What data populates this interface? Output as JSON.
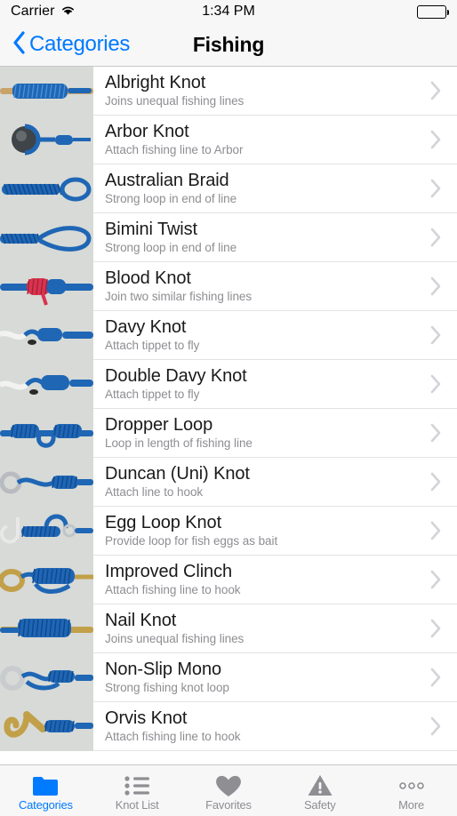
{
  "status_bar": {
    "carrier": "Carrier",
    "wifi_icon": "wifi-icon",
    "time": "1:34 PM",
    "battery_icon": "battery-full-icon"
  },
  "nav_bar": {
    "back_icon": "chevron-left-icon",
    "back_label": "Categories",
    "title": "Fishing"
  },
  "colors": {
    "accent": "#007aff",
    "title_text": "#1a1a1a",
    "subtitle_text": "#8e8e93",
    "separator": "#e3e3e6",
    "bar_background": "#f7f7f7",
    "chevron": "#d3d3d8"
  },
  "list": {
    "disclosure_icon": "chevron-right-icon",
    "items": [
      {
        "title": "Albright Knot",
        "subtitle": "Joins unequal fishing lines",
        "thumb": "knot-photo-albright"
      },
      {
        "title": "Arbor Knot",
        "subtitle": "Attach fishing line to Arbor",
        "thumb": "knot-photo-arbor"
      },
      {
        "title": "Australian Braid",
        "subtitle": "Strong loop in end of line",
        "thumb": "knot-photo-australian-braid"
      },
      {
        "title": "Bimini Twist",
        "subtitle": "Strong loop in end of line",
        "thumb": "knot-photo-bimini-twist"
      },
      {
        "title": "Blood Knot",
        "subtitle": "Join two similar fishing lines",
        "thumb": "knot-photo-blood"
      },
      {
        "title": "Davy Knot",
        "subtitle": "Attach tippet to fly",
        "thumb": "knot-photo-davy"
      },
      {
        "title": "Double Davy Knot",
        "subtitle": "Attach tippet to fly",
        "thumb": "knot-photo-double-davy"
      },
      {
        "title": "Dropper Loop",
        "subtitle": "Loop in length of fishing line",
        "thumb": "knot-photo-dropper-loop"
      },
      {
        "title": "Duncan (Uni) Knot",
        "subtitle": "Attach line to hook",
        "thumb": "knot-photo-duncan-uni"
      },
      {
        "title": "Egg Loop Knot",
        "subtitle": "Provide loop for fish eggs as bait",
        "thumb": "knot-photo-egg-loop"
      },
      {
        "title": "Improved Clinch",
        "subtitle": "Attach fishing line to hook",
        "thumb": "knot-photo-improved-clinch"
      },
      {
        "title": "Nail Knot",
        "subtitle": "Joins unequal fishing lines",
        "thumb": "knot-photo-nail"
      },
      {
        "title": "Non-Slip Mono",
        "subtitle": "Strong fishing knot loop",
        "thumb": "knot-photo-non-slip-mono"
      },
      {
        "title": "Orvis Knot",
        "subtitle": "Attach fishing line to hook",
        "thumb": "knot-photo-orvis"
      }
    ]
  },
  "tab_bar": {
    "active_index": 0,
    "items": [
      {
        "label": "Categories",
        "icon": "folder-icon"
      },
      {
        "label": "Knot List",
        "icon": "bulleted-list-icon"
      },
      {
        "label": "Favorites",
        "icon": "heart-icon"
      },
      {
        "label": "Safety",
        "icon": "warning-triangle-icon"
      },
      {
        "label": "More",
        "icon": "ellipsis-icon"
      }
    ]
  }
}
